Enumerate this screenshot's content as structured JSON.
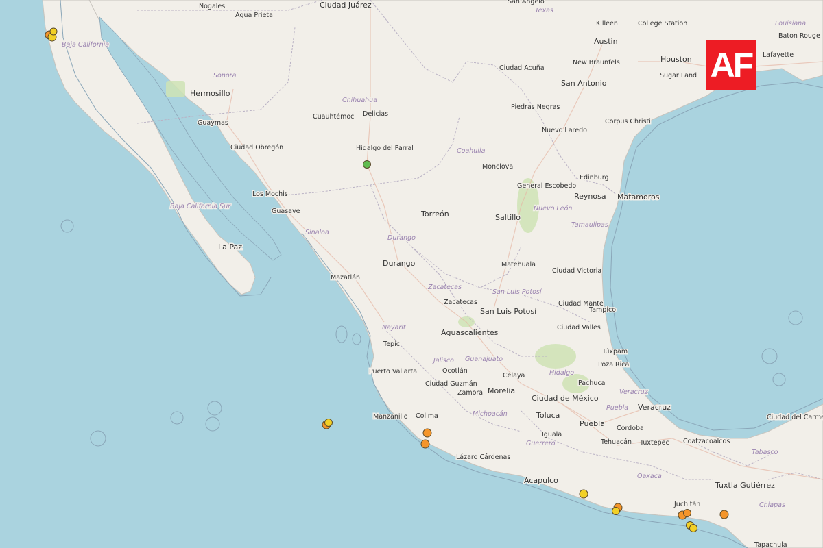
{
  "map": {
    "country_labels": [
      {
        "name": "Nogales",
        "kind": "small"
      },
      {
        "name": "Agua Prieta",
        "kind": "small"
      },
      {
        "name": "Ciudad Juárez",
        "kind": "med"
      },
      {
        "name": "San Angelo",
        "kind": "small"
      },
      {
        "name": "Killeen",
        "kind": "small"
      },
      {
        "name": "College Station",
        "kind": "small"
      },
      {
        "name": "Baton Rouge",
        "kind": "small"
      },
      {
        "name": "Austin",
        "kind": "med"
      },
      {
        "name": "New Braunfels",
        "kind": "small"
      },
      {
        "name": "Houston",
        "kind": "med"
      },
      {
        "name": "Lafayette",
        "kind": "small"
      },
      {
        "name": "San Antonio",
        "kind": "med"
      },
      {
        "name": "Sugar Land",
        "kind": "small"
      },
      {
        "name": "Ciudad Acuña",
        "kind": "small"
      },
      {
        "name": "Hermosillo",
        "kind": "med"
      },
      {
        "name": "Cuauhtémoc",
        "kind": "small"
      },
      {
        "name": "Delicias",
        "kind": "small"
      },
      {
        "name": "Piedras Negras",
        "kind": "small"
      },
      {
        "name": "Corpus Christi",
        "kind": "small"
      },
      {
        "name": "Guaymas",
        "kind": "small"
      },
      {
        "name": "Nuevo Laredo",
        "kind": "small"
      },
      {
        "name": "Ciudad Obregón",
        "kind": "small"
      },
      {
        "name": "Hidalgo del Parral",
        "kind": "small"
      },
      {
        "name": "Monclova",
        "kind": "small"
      },
      {
        "name": "Edinburg",
        "kind": "small"
      },
      {
        "name": "General Escobedo",
        "kind": "small"
      },
      {
        "name": "Reynosa",
        "kind": "med"
      },
      {
        "name": "Matamoros",
        "kind": "med"
      },
      {
        "name": "Los Mochis",
        "kind": "small"
      },
      {
        "name": "Guasave",
        "kind": "small"
      },
      {
        "name": "Torreón",
        "kind": "med"
      },
      {
        "name": "Saltillo",
        "kind": "med"
      },
      {
        "name": "La Paz",
        "kind": "med"
      },
      {
        "name": "Durango",
        "kind": "med"
      },
      {
        "name": "Matehuala",
        "kind": "small"
      },
      {
        "name": "Ciudad Victoria",
        "kind": "small"
      },
      {
        "name": "Mazatlán",
        "kind": "small"
      },
      {
        "name": "Zacatecas",
        "kind": "small"
      },
      {
        "name": "Ciudad Mante",
        "kind": "small"
      },
      {
        "name": "San Luis Potosí",
        "kind": "med"
      },
      {
        "name": "Tampico",
        "kind": "small"
      },
      {
        "name": "Ciudad Valles",
        "kind": "small"
      },
      {
        "name": "Aguascalientes",
        "kind": "med"
      },
      {
        "name": "Tepic",
        "kind": "small"
      },
      {
        "name": "Túxpam",
        "kind": "small"
      },
      {
        "name": "Puerto Vallarta",
        "kind": "small"
      },
      {
        "name": "Ocotlán",
        "kind": "small"
      },
      {
        "name": "Celaya",
        "kind": "small"
      },
      {
        "name": "Pachuca",
        "kind": "small"
      },
      {
        "name": "Poza Rica",
        "kind": "small"
      },
      {
        "name": "Ciudad Guzmán",
        "kind": "small"
      },
      {
        "name": "Zamora",
        "kind": "small"
      },
      {
        "name": "Morelia",
        "kind": "med"
      },
      {
        "name": "Ciudad de México",
        "kind": "med"
      },
      {
        "name": "Veracruz",
        "kind": "med"
      },
      {
        "name": "Manzanillo",
        "kind": "small"
      },
      {
        "name": "Colima",
        "kind": "small"
      },
      {
        "name": "Toluca",
        "kind": "med"
      },
      {
        "name": "Puebla",
        "kind": "med"
      },
      {
        "name": "Córdoba",
        "kind": "small"
      },
      {
        "name": "Iguala",
        "kind": "small"
      },
      {
        "name": "Tehuacán",
        "kind": "small"
      },
      {
        "name": "Tuxtepec",
        "kind": "small"
      },
      {
        "name": "Coatzacoalcos",
        "kind": "small"
      },
      {
        "name": "Ciudad del Carmen",
        "kind": "small"
      },
      {
        "name": "Lázaro Cárdenas",
        "kind": "small"
      },
      {
        "name": "Acapulco",
        "kind": "med"
      },
      {
        "name": "Tuxtla Gutiérrez",
        "kind": "med"
      },
      {
        "name": "Juchitán",
        "kind": "small"
      },
      {
        "name": "Tapachula",
        "kind": "small"
      }
    ],
    "state_labels": [
      "Texas",
      "Louisiana",
      "Baja California",
      "Sonora",
      "Chihuahua",
      "Coahuila",
      "Nuevo León",
      "Tamaulipas",
      "Baja California Sur",
      "Sinaloa",
      "Durango",
      "Zacatecas",
      "San Luis Potosí",
      "Nayarit",
      "Jalisco",
      "Guanajuato",
      "Hidalgo",
      "Veracruz",
      "Michoacán",
      "Puebla",
      "Guerrero",
      "Oaxaca",
      "Tabasco",
      "Chiapas"
    ],
    "colors": {
      "water": "#aad3df",
      "land": "#f2efe9",
      "border": "#9e9aa6",
      "coast_ring": "#8aa6b8",
      "quake_orange": "#f4952a",
      "quake_yellow": "#f2d026",
      "quake_green": "#5fbb4e"
    },
    "earthquakes": [
      {
        "level": "orange"
      },
      {
        "level": "yellow"
      },
      {
        "level": "yellow"
      },
      {
        "level": "green"
      },
      {
        "level": "orange"
      },
      {
        "level": "yellow"
      },
      {
        "level": "orange"
      },
      {
        "level": "orange"
      },
      {
        "level": "yellow"
      },
      {
        "level": "orange"
      },
      {
        "level": "yellow"
      },
      {
        "level": "orange"
      },
      {
        "level": "orange"
      },
      {
        "level": "yellow"
      },
      {
        "level": "yellow"
      },
      {
        "level": "orange"
      }
    ]
  },
  "logo": {
    "text": "AF",
    "color": "#ed1c24"
  }
}
